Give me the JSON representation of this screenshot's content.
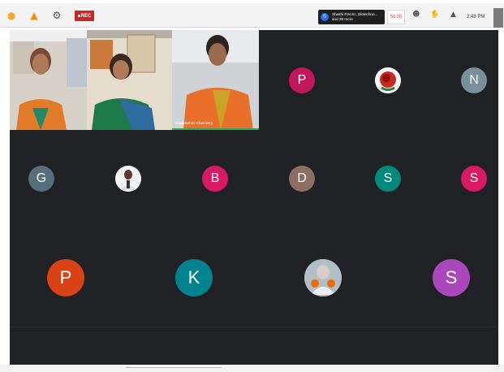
{
  "topbar": {
    "recording_label": "REC",
    "speaker_initial": "S",
    "speaker_text": "Shashi P.M.Sc, Biotechno... and 39 more",
    "time_badge": "56:20",
    "clock": "2:48 PM"
  },
  "video_tiles": [
    {
      "id": "tile-1",
      "name": ""
    },
    {
      "id": "tile-2",
      "name": ""
    },
    {
      "id": "tile-3",
      "name": "Rajalakshmi Chemistry"
    }
  ],
  "participants_row1": [
    {
      "initial": "P",
      "color": "#c2185b"
    },
    {
      "initial": "",
      "type": "photo-rose"
    },
    {
      "initial": "N",
      "color": "#78909c"
    }
  ],
  "participants_row2": [
    {
      "initial": "G",
      "color": "#546e7a"
    },
    {
      "initial": "",
      "type": "photo-man"
    },
    {
      "initial": "B",
      "color": "#d81b60"
    },
    {
      "initial": "D",
      "color": "#8d6e63"
    },
    {
      "initial": "S",
      "color": "#00897b"
    },
    {
      "initial": "S",
      "color": "#d81b60"
    }
  ],
  "participants_row3": [
    {
      "initial": "P",
      "color": "#d84315"
    },
    {
      "initial": "K",
      "color": "#00838f"
    },
    {
      "initial": "",
      "type": "photo-child"
    },
    {
      "initial": "S",
      "color": "#ab47bc"
    }
  ],
  "colors": {
    "stage_bg": "#202124",
    "topbar_bg": "#f3f3f3",
    "rec_red": "#c62828"
  }
}
